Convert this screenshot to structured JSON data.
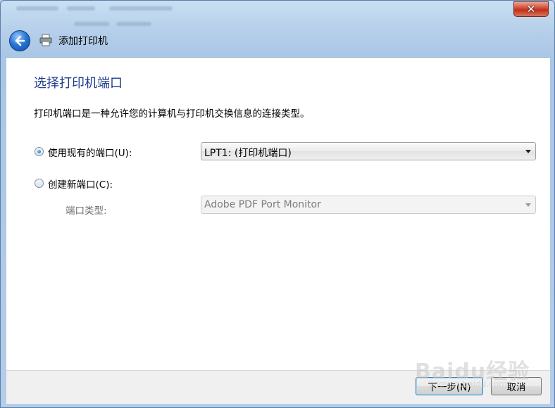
{
  "window": {
    "title": "添加打印机"
  },
  "page": {
    "heading": "选择打印机端口",
    "description": "打印机端口是一种允许您的计算机与打印机交换信息的连接类型。"
  },
  "options": {
    "existing_port": {
      "label": "使用现有的端口(U):",
      "checked": true,
      "value": "LPT1: (打印机端口)"
    },
    "new_port": {
      "label": "创建新端口(C):",
      "checked": false,
      "type_label": "端口类型:",
      "type_value": "Adobe PDF Port Monitor"
    }
  },
  "buttons": {
    "next": "下一步(N)",
    "cancel": "取消"
  },
  "watermark": {
    "text": "Baidu经验",
    "sub": "jingyan.baidu.com"
  }
}
